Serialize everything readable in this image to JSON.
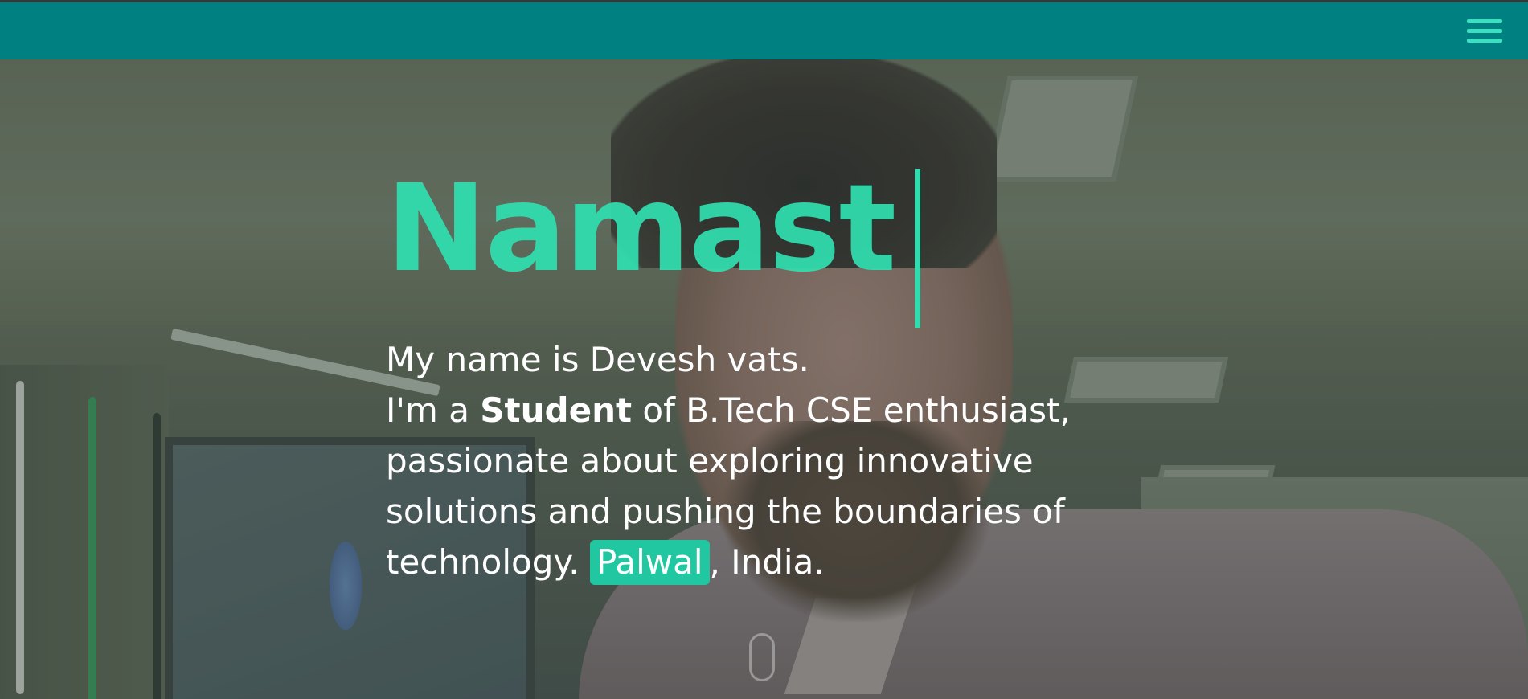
{
  "header": {
    "menu_icon": "hamburger-menu-icon"
  },
  "hero": {
    "greeting": "Namast",
    "intro_line1": "My name is Devesh vats.",
    "intro_prefix": "I'm a ",
    "intro_role": "Student",
    "intro_rest": " of B.Tech CSE enthusiast, passionate about exploring innovative solutions and pushing the boundaries of technology. ",
    "location_tag": "Palwal",
    "location_suffix": ", India."
  },
  "colors": {
    "topbar": "#008080",
    "accent": "#30e0b0",
    "tag_bg": "#21c7a0",
    "text": "#ffffff"
  }
}
